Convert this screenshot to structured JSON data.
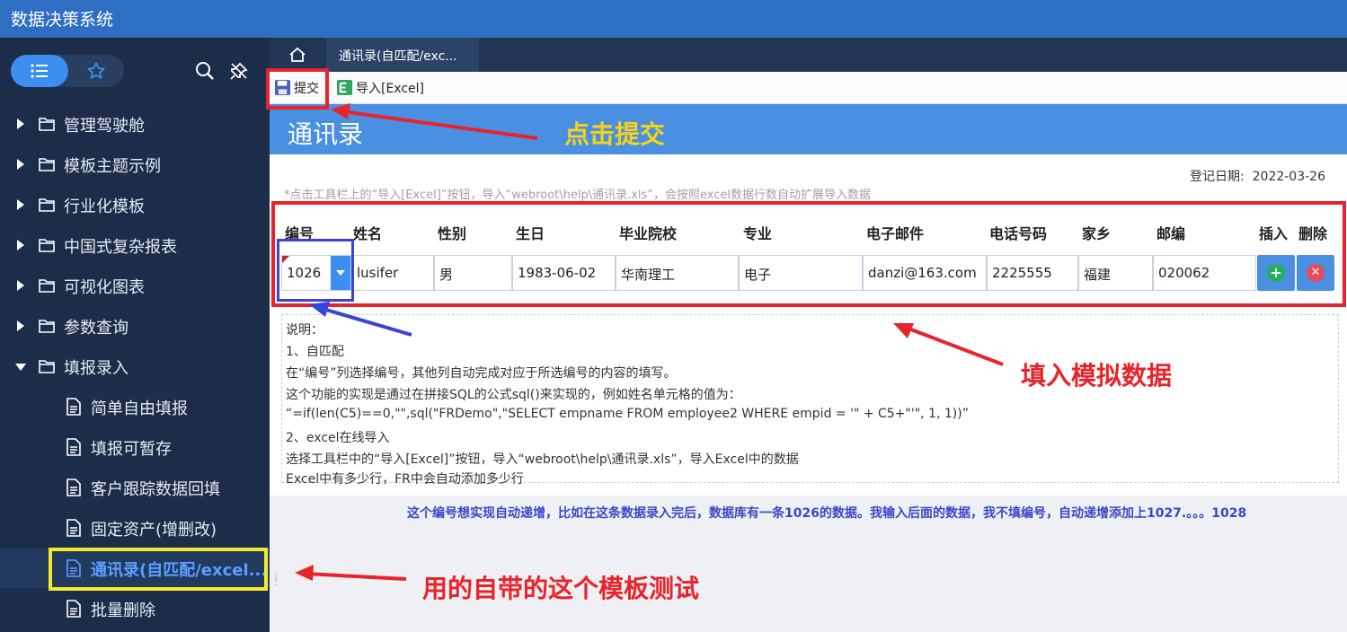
{
  "app": {
    "title": "数据决策系统"
  },
  "sidebar": {
    "items": [
      {
        "label": "管理驾驶舱",
        "type": "folder"
      },
      {
        "label": "模板主题示例",
        "type": "folder"
      },
      {
        "label": "行业化模板",
        "type": "folder"
      },
      {
        "label": "中国式复杂报表",
        "type": "folder"
      },
      {
        "label": "可视化图表",
        "type": "folder"
      },
      {
        "label": "参数查询",
        "type": "folder"
      },
      {
        "label": "填报录入",
        "type": "folder-open"
      }
    ],
    "leaves": [
      {
        "label": "简单自由填报"
      },
      {
        "label": "填报可暂存"
      },
      {
        "label": "客户跟踪数据回填"
      },
      {
        "label": "固定资产(增删改)"
      },
      {
        "label": "通讯录(自匹配/excel...",
        "active": true
      },
      {
        "label": "批量删除"
      }
    ]
  },
  "tabs": {
    "active_label": "通讯录(自匹配/exc..."
  },
  "toolbar": {
    "submit_label": "提交",
    "import_label": "导入[Excel]"
  },
  "report": {
    "title": "通讯录",
    "reg_date_label": "登记日期:",
    "reg_date": "2022-03-26",
    "hint": "*点击工具栏上的“导入[Excel]”按钮，导入“webroot\\help\\通讯录.xls”，会按照excel数据行数自动扩展导入数据"
  },
  "table": {
    "headers": [
      "编号",
      "姓名",
      "性别",
      "生日",
      "毕业院校",
      "专业",
      "电子邮件",
      "电话号码",
      "家乡",
      "邮编",
      "插入",
      "删除"
    ],
    "row": [
      "1026",
      "lusifer",
      "男",
      "1983-06-02",
      "华南理工",
      "电子",
      "danzi@163.com",
      "2225555",
      "福建",
      "020062"
    ]
  },
  "description": {
    "lines": [
      "说明：",
      "1、自匹配",
      "   在“编号”列选择编号，其他列自动完成对应于所选编号的内容的填写。",
      "   这个功能的实现是通过在拼接SQL的公式sql()来实现的，例如姓名单元格的值为：",
      "    “=if(len(C5)==0,\"\",sql(\"FRDemo\",\"SELECT empname FROM employee2 WHERE empid = '\" + C5+\"'\", 1, 1))”",
      "2、excel在线导入",
      "   选择工具栏中的“导入[Excel]”按钮，导入“webroot\\help\\通讯录.xls”，导入Excel中的数据",
      "   Excel中有多少行，FR中会自动添加多少行"
    ]
  },
  "note": "这个编号想实现自动递增，比如在这条数据录入完后，数据库有一条1026的数据。我输入后面的数据，我不填编号，自动递增添加上1027.。。。1028",
  "annotations": {
    "submit": "点击提交",
    "fill": "填入模拟数据",
    "template": "用的自带的这个模板测试"
  },
  "colors": {
    "topbar": "#2e6fc4",
    "sidebar": "#1c2d4a",
    "banner": "#4a90e2",
    "accent": "#3c8ef0",
    "annotation_red": "#e8232a",
    "annotation_yellow": "#f6d21a",
    "annotation_blue": "#3a43d6"
  },
  "icons": [
    "list-icon",
    "star-icon",
    "search-icon",
    "unpin-icon",
    "home-icon",
    "save-icon",
    "excel-icon",
    "folder-icon",
    "document-icon",
    "plus-icon",
    "close-icon",
    "caret-right-icon",
    "caret-down-icon"
  ]
}
